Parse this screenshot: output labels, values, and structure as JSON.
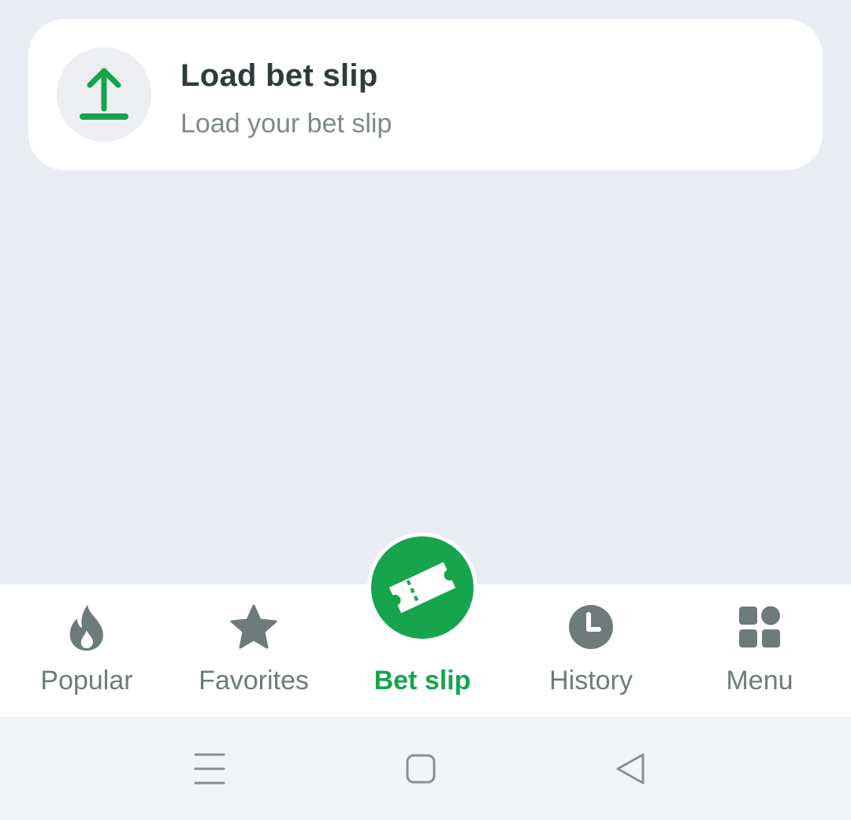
{
  "load_card": {
    "title": "Load bet slip",
    "subtitle": "Load your bet slip",
    "icon": "upload-icon"
  },
  "bottom_nav": {
    "items": [
      {
        "label": "Popular",
        "icon": "flame-icon",
        "active": false
      },
      {
        "label": "Favorites",
        "icon": "star-icon",
        "active": false
      },
      {
        "label": "Bet slip",
        "icon": "ticket-icon",
        "active": true
      },
      {
        "label": "History",
        "icon": "clock-icon",
        "active": false
      },
      {
        "label": "Menu",
        "icon": "grid-icon",
        "active": false
      }
    ]
  },
  "system_nav": {
    "buttons": [
      "recents-icon",
      "home-icon",
      "back-icon"
    ]
  },
  "colors": {
    "accent": "#16a44d",
    "inactive": "#6e7b7b",
    "background": "#e9ecf2",
    "card": "#ffffff"
  }
}
